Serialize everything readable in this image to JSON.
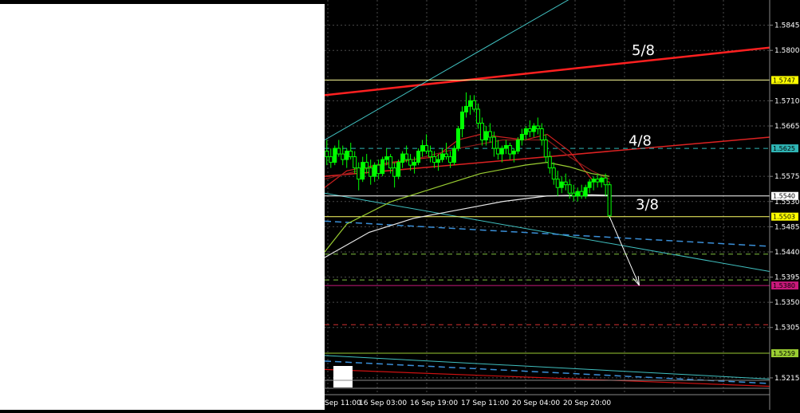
{
  "chart_data": {
    "type": "candlestick",
    "ylim": [
      1.5185,
      1.589
    ],
    "grid": true,
    "y_ticks": [
      {
        "label": "1.5845",
        "value": 1.5845
      },
      {
        "label": "1.5800",
        "value": 1.58
      },
      {
        "label": "1.5710",
        "value": 1.571
      },
      {
        "label": "1.5665",
        "value": 1.5665
      },
      {
        "label": "1.5575",
        "value": 1.5575
      },
      {
        "label": "1.5530",
        "value": 1.553
      },
      {
        "label": "1.5485",
        "value": 1.5485
      },
      {
        "label": "1.5440",
        "value": 1.544
      },
      {
        "label": "1.5395",
        "value": 1.5395
      },
      {
        "label": "1.5350",
        "value": 1.535
      },
      {
        "label": "1.5305",
        "value": 1.5305
      },
      {
        "label": "1.5215",
        "value": 1.5215
      }
    ],
    "x_ticks": [
      "Sep 11:00",
      "16 Sep 03:00",
      "16 Sep 19:00",
      "17 Sep 11:00",
      "20 Sep 04:00",
      "20 Sep 20:00"
    ],
    "price_badges": [
      {
        "label": "1.5747",
        "value": 1.5747,
        "bg": "#ffff00",
        "fg": "#000000"
      },
      {
        "label": "1.5625",
        "value": 1.5625,
        "bg": "#2fb5b5",
        "fg": "#000000"
      },
      {
        "label": "1.5540",
        "value": 1.554,
        "bg": "#ffffff",
        "fg": "#000000"
      },
      {
        "label": "1.5503",
        "value": 1.5503,
        "bg": "#ffff00",
        "fg": "#000000"
      },
      {
        "label": "1.5380",
        "value": 1.538,
        "bg": "#c8197a",
        "fg": "#000000"
      },
      {
        "label": "1.5259",
        "value": 1.5259,
        "bg": "#9acd32",
        "fg": "#000000"
      }
    ],
    "levels": [
      {
        "name": "level-1.5747",
        "value": 1.5747,
        "color": "#ffff99",
        "dash": false
      },
      {
        "name": "level-1.5625",
        "value": 1.5625,
        "color": "#2fb5b5",
        "dash": true
      },
      {
        "name": "level-1.5540",
        "value": 1.554,
        "color": "#ffffff",
        "dash": false
      },
      {
        "name": "level-1.5503",
        "value": 1.5503,
        "color": "#ffff66",
        "dash": false
      },
      {
        "name": "level-1.5380",
        "value": 1.538,
        "color": "#c8197a",
        "dash": false
      },
      {
        "name": "level-1.5259",
        "value": 1.5259,
        "color": "#9acd32",
        "dash": false
      },
      {
        "name": "level-1.5436",
        "value": 1.5436,
        "color": "#7fbf3f",
        "dash": true
      },
      {
        "name": "level-1.5390",
        "value": 1.539,
        "color": "#7fbf3f",
        "dash": true
      },
      {
        "name": "level-1.5310",
        "value": 1.531,
        "color": "#d03030",
        "dash": true
      }
    ],
    "fib_labels": [
      {
        "text": "5/8",
        "value": 1.5792
      },
      {
        "text": "4/8",
        "value": 1.563
      },
      {
        "text": "3/8",
        "value": 1.5516
      }
    ],
    "trendlines": [
      {
        "name": "red-upper-channel",
        "color": "#ff2020",
        "width": 2.5,
        "dash": false,
        "from": [
          0.0,
          1.572
        ],
        "to": [
          1.0,
          1.5805
        ]
      },
      {
        "name": "red-middle-channel",
        "color": "#dd2222",
        "width": 1.5,
        "dash": false,
        "from": [
          0.0,
          1.5575
        ],
        "to": [
          1.0,
          1.5645
        ]
      },
      {
        "name": "cyan-rising-line",
        "color": "#40c0c0",
        "width": 1,
        "dash": false,
        "from": [
          0.0,
          1.564
        ],
        "to": [
          0.58,
          1.5905
        ]
      },
      {
        "name": "cyan-falling-line",
        "color": "#40c0c0",
        "width": 1,
        "dash": false,
        "from": [
          0.0,
          1.5545
        ],
        "to": [
          1.0,
          1.5405
        ]
      },
      {
        "name": "blue-dashed-upper",
        "color": "#3a8fd8",
        "width": 1.5,
        "dash": true,
        "from": [
          0.0,
          1.5495
        ],
        "to": [
          1.0,
          1.545
        ]
      },
      {
        "name": "blue-dashed-lower",
        "color": "#3a8fd8",
        "width": 1.5,
        "dash": true,
        "from": [
          0.0,
          1.5245
        ],
        "to": [
          1.0,
          1.5205
        ]
      },
      {
        "name": "red-lower-line",
        "color": "#cc1111",
        "width": 1.2,
        "dash": false,
        "from": [
          0.0,
          1.523
        ],
        "to": [
          1.0,
          1.52
        ]
      },
      {
        "name": "cyan-lower-line",
        "color": "#40c0c0",
        "width": 1,
        "dash": false,
        "from": [
          0.0,
          1.5255
        ],
        "to": [
          1.0,
          1.5213
        ]
      }
    ],
    "forecast_arrow": {
      "from": [
        0.64,
        1.5503
      ],
      "to": [
        0.707,
        1.538
      ]
    },
    "moving_averages": [
      {
        "name": "ma-red",
        "color": "#cc2020",
        "points": [
          [
            0.0,
            1.5555
          ],
          [
            0.05,
            1.5585
          ],
          [
            0.15,
            1.56
          ],
          [
            0.25,
            1.561
          ],
          [
            0.3,
            1.564
          ],
          [
            0.35,
            1.565
          ],
          [
            0.45,
            1.564
          ],
          [
            0.5,
            1.565
          ],
          [
            0.55,
            1.562
          ],
          [
            0.6,
            1.557
          ],
          [
            0.64,
            1.5565
          ]
        ]
      },
      {
        "name": "ma-darkred",
        "color": "#8b1a1a",
        "points": [
          [
            0.0,
            1.557
          ],
          [
            0.1,
            1.559
          ],
          [
            0.2,
            1.5605
          ],
          [
            0.3,
            1.5625
          ],
          [
            0.4,
            1.564
          ],
          [
            0.5,
            1.564
          ],
          [
            0.55,
            1.561
          ],
          [
            0.6,
            1.5585
          ],
          [
            0.64,
            1.557
          ]
        ]
      },
      {
        "name": "ma-green",
        "color": "#9acd32",
        "points": [
          [
            0.0,
            1.544
          ],
          [
            0.05,
            1.549
          ],
          [
            0.15,
            1.553
          ],
          [
            0.25,
            1.5555
          ],
          [
            0.35,
            1.558
          ],
          [
            0.45,
            1.5595
          ],
          [
            0.5,
            1.56
          ],
          [
            0.55,
            1.5592
          ],
          [
            0.6,
            1.558
          ],
          [
            0.64,
            1.5575
          ]
        ]
      },
      {
        "name": "ma-white",
        "color": "#e8e8e8",
        "points": [
          [
            0.0,
            1.543
          ],
          [
            0.1,
            1.5475
          ],
          [
            0.2,
            1.55
          ],
          [
            0.3,
            1.5515
          ],
          [
            0.4,
            1.553
          ],
          [
            0.5,
            1.554
          ],
          [
            0.6,
            1.5542
          ],
          [
            0.64,
            1.5541
          ]
        ]
      }
    ],
    "candles": [
      [
        1.562,
        1.564,
        1.5595,
        1.561
      ],
      [
        1.561,
        1.5625,
        1.559,
        1.56
      ],
      [
        1.56,
        1.563,
        1.5595,
        1.5625
      ],
      [
        1.5625,
        1.564,
        1.561,
        1.5615
      ],
      [
        1.5615,
        1.563,
        1.5595,
        1.5605
      ],
      [
        1.5605,
        1.5625,
        1.559,
        1.562
      ],
      [
        1.562,
        1.5635,
        1.5605,
        1.561
      ],
      [
        1.561,
        1.562,
        1.558,
        1.559
      ],
      [
        1.559,
        1.56,
        1.555,
        1.557
      ],
      [
        1.557,
        1.561,
        1.5565,
        1.56
      ],
      [
        1.56,
        1.5615,
        1.558,
        1.559
      ],
      [
        1.559,
        1.5605,
        1.556,
        1.5575
      ],
      [
        1.5575,
        1.56,
        1.5565,
        1.5595
      ],
      [
        1.5595,
        1.5605,
        1.557,
        1.558
      ],
      [
        1.558,
        1.561,
        1.5575,
        1.5605
      ],
      [
        1.5605,
        1.5625,
        1.5595,
        1.561
      ],
      [
        1.561,
        1.5615,
        1.558,
        1.559
      ],
      [
        1.559,
        1.56,
        1.5555,
        1.5575
      ],
      [
        1.5575,
        1.5605,
        1.557,
        1.56
      ],
      [
        1.56,
        1.562,
        1.559,
        1.5615
      ],
      [
        1.5615,
        1.563,
        1.56,
        1.5605
      ],
      [
        1.5605,
        1.5615,
        1.5585,
        1.5595
      ],
      [
        1.5595,
        1.561,
        1.558,
        1.56
      ],
      [
        1.56,
        1.5625,
        1.5595,
        1.562
      ],
      [
        1.562,
        1.564,
        1.561,
        1.563
      ],
      [
        1.563,
        1.565,
        1.5615,
        1.562
      ],
      [
        1.562,
        1.563,
        1.56,
        1.561
      ],
      [
        1.561,
        1.562,
        1.559,
        1.56
      ],
      [
        1.56,
        1.5615,
        1.5585,
        1.5605
      ],
      [
        1.5605,
        1.5625,
        1.56,
        1.5615
      ],
      [
        1.5615,
        1.5635,
        1.5605,
        1.561
      ],
      [
        1.561,
        1.562,
        1.559,
        1.56
      ],
      [
        1.56,
        1.563,
        1.5595,
        1.5625
      ],
      [
        1.5625,
        1.5665,
        1.562,
        1.566
      ],
      [
        1.566,
        1.57,
        1.5645,
        1.569
      ],
      [
        1.569,
        1.5725,
        1.568,
        1.57
      ],
      [
        1.57,
        1.572,
        1.5685,
        1.571
      ],
      [
        1.571,
        1.572,
        1.569,
        1.5695
      ],
      [
        1.5695,
        1.5705,
        1.566,
        1.567
      ],
      [
        1.567,
        1.568,
        1.563,
        1.564
      ],
      [
        1.564,
        1.5665,
        1.563,
        1.5655
      ],
      [
        1.5655,
        1.567,
        1.5635,
        1.5645
      ],
      [
        1.5645,
        1.5655,
        1.561,
        1.5625
      ],
      [
        1.5625,
        1.564,
        1.5605,
        1.5615
      ],
      [
        1.5615,
        1.563,
        1.56,
        1.5625
      ],
      [
        1.5625,
        1.564,
        1.5615,
        1.563
      ],
      [
        1.563,
        1.5635,
        1.5605,
        1.5615
      ],
      [
        1.5615,
        1.5625,
        1.56,
        1.562
      ],
      [
        1.562,
        1.5645,
        1.5615,
        1.564
      ],
      [
        1.564,
        1.566,
        1.563,
        1.565
      ],
      [
        1.565,
        1.5665,
        1.564,
        1.566
      ],
      [
        1.566,
        1.5675,
        1.5645,
        1.5655
      ],
      [
        1.5655,
        1.567,
        1.5645,
        1.5665
      ],
      [
        1.5665,
        1.568,
        1.565,
        1.566
      ],
      [
        1.566,
        1.567,
        1.563,
        1.564
      ],
      [
        1.564,
        1.565,
        1.56,
        1.561
      ],
      [
        1.561,
        1.562,
        1.558,
        1.559
      ],
      [
        1.559,
        1.56,
        1.556,
        1.557
      ],
      [
        1.557,
        1.5585,
        1.554,
        1.5555
      ],
      [
        1.5555,
        1.5575,
        1.5545,
        1.5565
      ],
      [
        1.5565,
        1.558,
        1.555,
        1.556
      ],
      [
        1.556,
        1.557,
        1.5535,
        1.5545
      ],
      [
        1.5545,
        1.556,
        1.553,
        1.554
      ],
      [
        1.554,
        1.5555,
        1.553,
        1.5548
      ],
      [
        1.5548,
        1.556,
        1.5535,
        1.554
      ],
      [
        1.554,
        1.556,
        1.5535,
        1.5555
      ],
      [
        1.5555,
        1.557,
        1.5545,
        1.5565
      ],
      [
        1.5565,
        1.5575,
        1.555,
        1.557
      ],
      [
        1.557,
        1.558,
        1.5555,
        1.5565
      ],
      [
        1.5565,
        1.5575,
        1.5555,
        1.5572
      ],
      [
        1.5572,
        1.558,
        1.554,
        1.556
      ],
      [
        1.556,
        1.5565,
        1.55,
        1.5505
      ]
    ]
  }
}
